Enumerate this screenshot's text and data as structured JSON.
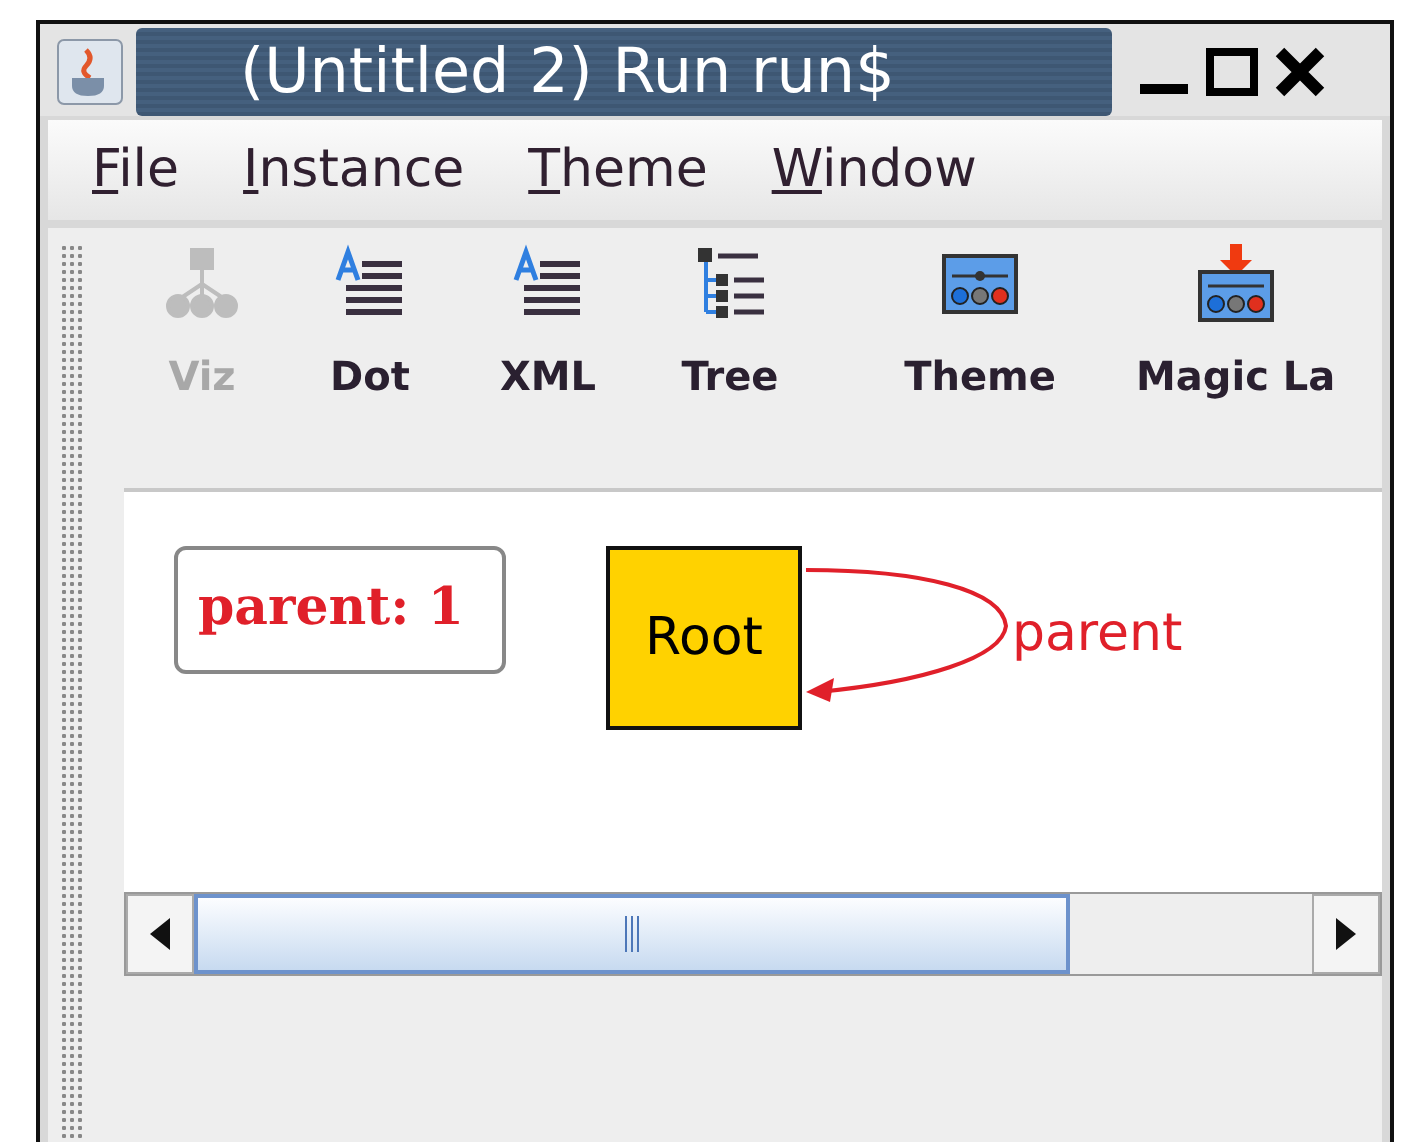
{
  "window": {
    "title": "(Untitled 2) Run run$"
  },
  "menu": [
    {
      "label": "File"
    },
    {
      "label": "Instance"
    },
    {
      "label": "Theme"
    },
    {
      "label": "Window"
    }
  ],
  "toolbar": [
    {
      "label": "Viz",
      "kind": "tree",
      "disabled": true
    },
    {
      "label": "Dot",
      "kind": "text",
      "disabled": false
    },
    {
      "label": "XML",
      "kind": "text",
      "disabled": false
    },
    {
      "label": "Tree",
      "kind": "outline",
      "disabled": false
    },
    {
      "label": "Theme",
      "kind": "theme",
      "disabled": false
    },
    {
      "label": "Magic La",
      "kind": "magic",
      "disabled": false
    }
  ],
  "graph": {
    "label_box": "parent: 1",
    "node": "Root",
    "edge_label": "parent"
  }
}
